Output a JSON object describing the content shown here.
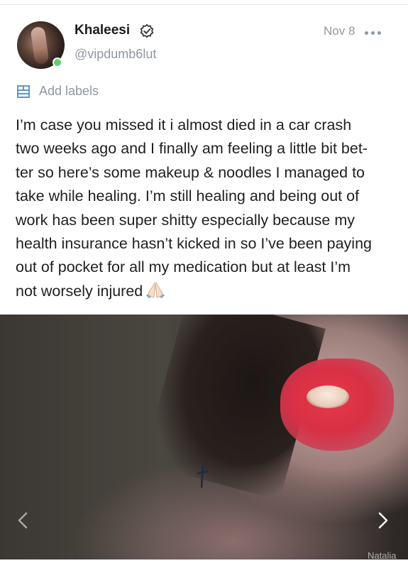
{
  "post": {
    "author": {
      "display_name": "Khaleesi",
      "handle": "@vipdumb6lut",
      "verified": true,
      "online": true,
      "avatar_icon": "avatar-photo"
    },
    "date": "Nov 8",
    "more_icon": "more-horizontal-icon",
    "labels": {
      "icon": "labels-icon",
      "label": "Add labels"
    },
    "body_lines": [
      "I’m case you missed it i almost died in a car crash",
      "two weeks ago and I finally am feeling a little bit bet-",
      "ter so here’s some makeup & noodles I managed to",
      "take while healing. I’m still healing and being out of",
      "work has been super shitty especially because my",
      "health insurance hasn’t kicked in so I’ve been paying",
      "out of pocket for all my medication but at least I’m",
      "not worsely injured"
    ],
    "body_end_icon": "praying-hands-emoji",
    "media": {
      "watermark": "Natalia",
      "prev_icon": "chevron-left-icon",
      "next_icon": "chevron-right-icon"
    }
  },
  "colors": {
    "muted": "#8f97a1",
    "text": "#1f1f1f",
    "online": "#5fd16c",
    "accent_icon": "#4c8dc9"
  }
}
